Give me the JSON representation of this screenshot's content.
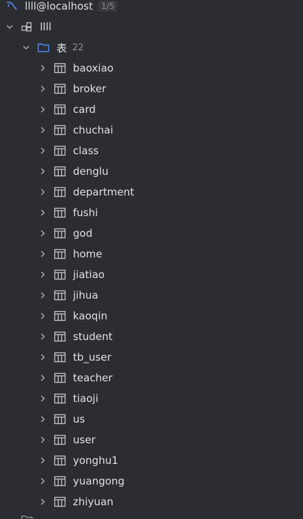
{
  "connection": {
    "name": "llll@localhost",
    "badge": "1/5",
    "icon": "mysql-dolphin-icon"
  },
  "schema": {
    "name": "llll",
    "icon": "schema-icon"
  },
  "tables_folder": {
    "label": "表",
    "count": "22",
    "icon": "folder-icon"
  },
  "tables": [
    "baoxiao",
    "broker",
    "card",
    "chuchai",
    "class",
    "denglu",
    "department",
    "fushi",
    "god",
    "home",
    "jiatiao",
    "jihua",
    "kaoqin",
    "student",
    "tb_user",
    "teacher",
    "tiaoji",
    "us",
    "user",
    "yonghu1",
    "yuangong",
    "zhiyuan"
  ],
  "colors": {
    "background": "#2b2d30",
    "text": "#dfe1e5",
    "muted": "#8c8f94",
    "accent": "#548af7"
  }
}
